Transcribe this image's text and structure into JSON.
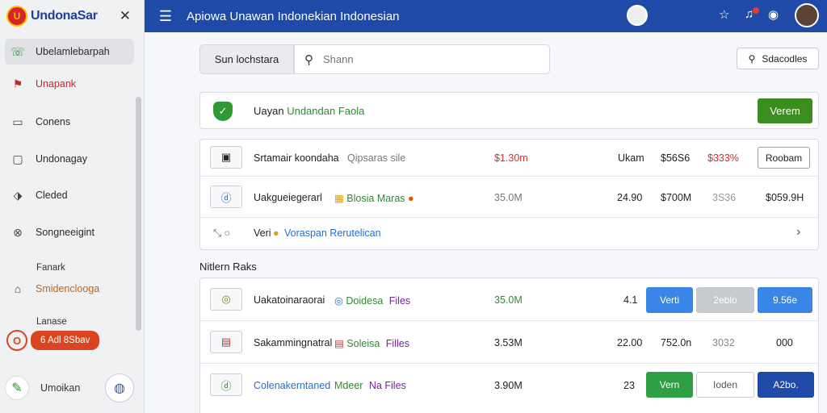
{
  "app": {
    "name": "UndonaSar",
    "logo_mark": "U"
  },
  "topbar": {
    "title": "Apiowa Unawan Indonekian Indonesian"
  },
  "sidebar": {
    "items": [
      {
        "label": "Ubelamlebarpah",
        "icon": "phone-icon"
      },
      {
        "label": "Unapank",
        "icon": "flag-icon"
      },
      {
        "label": "Conens",
        "icon": "card-icon"
      },
      {
        "label": "Undonagay",
        "icon": "shopping-bag-icon"
      },
      {
        "label": "Cleded",
        "icon": "tag-icon"
      },
      {
        "label": "Songneeigint",
        "icon": "network-icon"
      }
    ],
    "section_label": "Fanark",
    "home_item": {
      "label": "Smidenclooga",
      "icon": "home-icon"
    },
    "section_label_2": "Lanase",
    "badge": {
      "circle": "O",
      "pill": "6 Adl 8Sbav"
    },
    "footer_label": "Umoikan"
  },
  "search": {
    "segment_label": "Sun lochstara",
    "placeholder": "Shann",
    "right_button": "Sdacodles"
  },
  "banner": {
    "text_before": "Uayan ",
    "text_green": "Undandan Faola",
    "button": "Verem"
  },
  "table1": {
    "rows": [
      {
        "icon": "doc-icon",
        "name": "Srtamair koondaha",
        "sub": "Qipsaras sile",
        "amount": "$1.30m",
        "label": "Ukam",
        "v1": "$56S6",
        "v2": "$333%",
        "action": "Roobam"
      },
      {
        "icon": "info-icon",
        "name": "Uakgueiegerarl",
        "tag": "Blosia Maras",
        "amount": "35.0M",
        "v1": "24.90",
        "v2": "$700M",
        "v3": "3S36",
        "v4": "$059.9H"
      }
    ],
    "footer": {
      "prefix": "Veri",
      "link": "Voraspan Rerutelican"
    }
  },
  "section_title": "Nitlern Raks",
  "table2": {
    "rows": [
      {
        "icon": "circle-icon",
        "name": "Uakatoinaraorai",
        "tag": "Doidesa",
        "tag2": "Files",
        "amount": "35.0M",
        "v1": "4.1",
        "b1": "Verti",
        "b2": "2eblo",
        "b3": "9.56e"
      },
      {
        "icon": "table-icon",
        "name": "Sakammingnatral",
        "tag": "Soleisa",
        "tag2": "Filles",
        "amount": "3.53M",
        "v1": "22.00",
        "v2": "752.0n",
        "v3": "3032",
        "v4": "000"
      },
      {
        "icon": "check-icon",
        "name": "Colenakerntaned",
        "tag": "Mdeer",
        "tag2": "Na Files",
        "amount": "3.90M",
        "v1": "23",
        "b1": "Vern",
        "b2": "Ioden",
        "b3": "A2bo."
      }
    ]
  },
  "colors": {
    "primary": "#1f4aa8",
    "green": "#3a8d1e",
    "orange": "#d8451e",
    "blue_btn": "#3a86e6"
  }
}
